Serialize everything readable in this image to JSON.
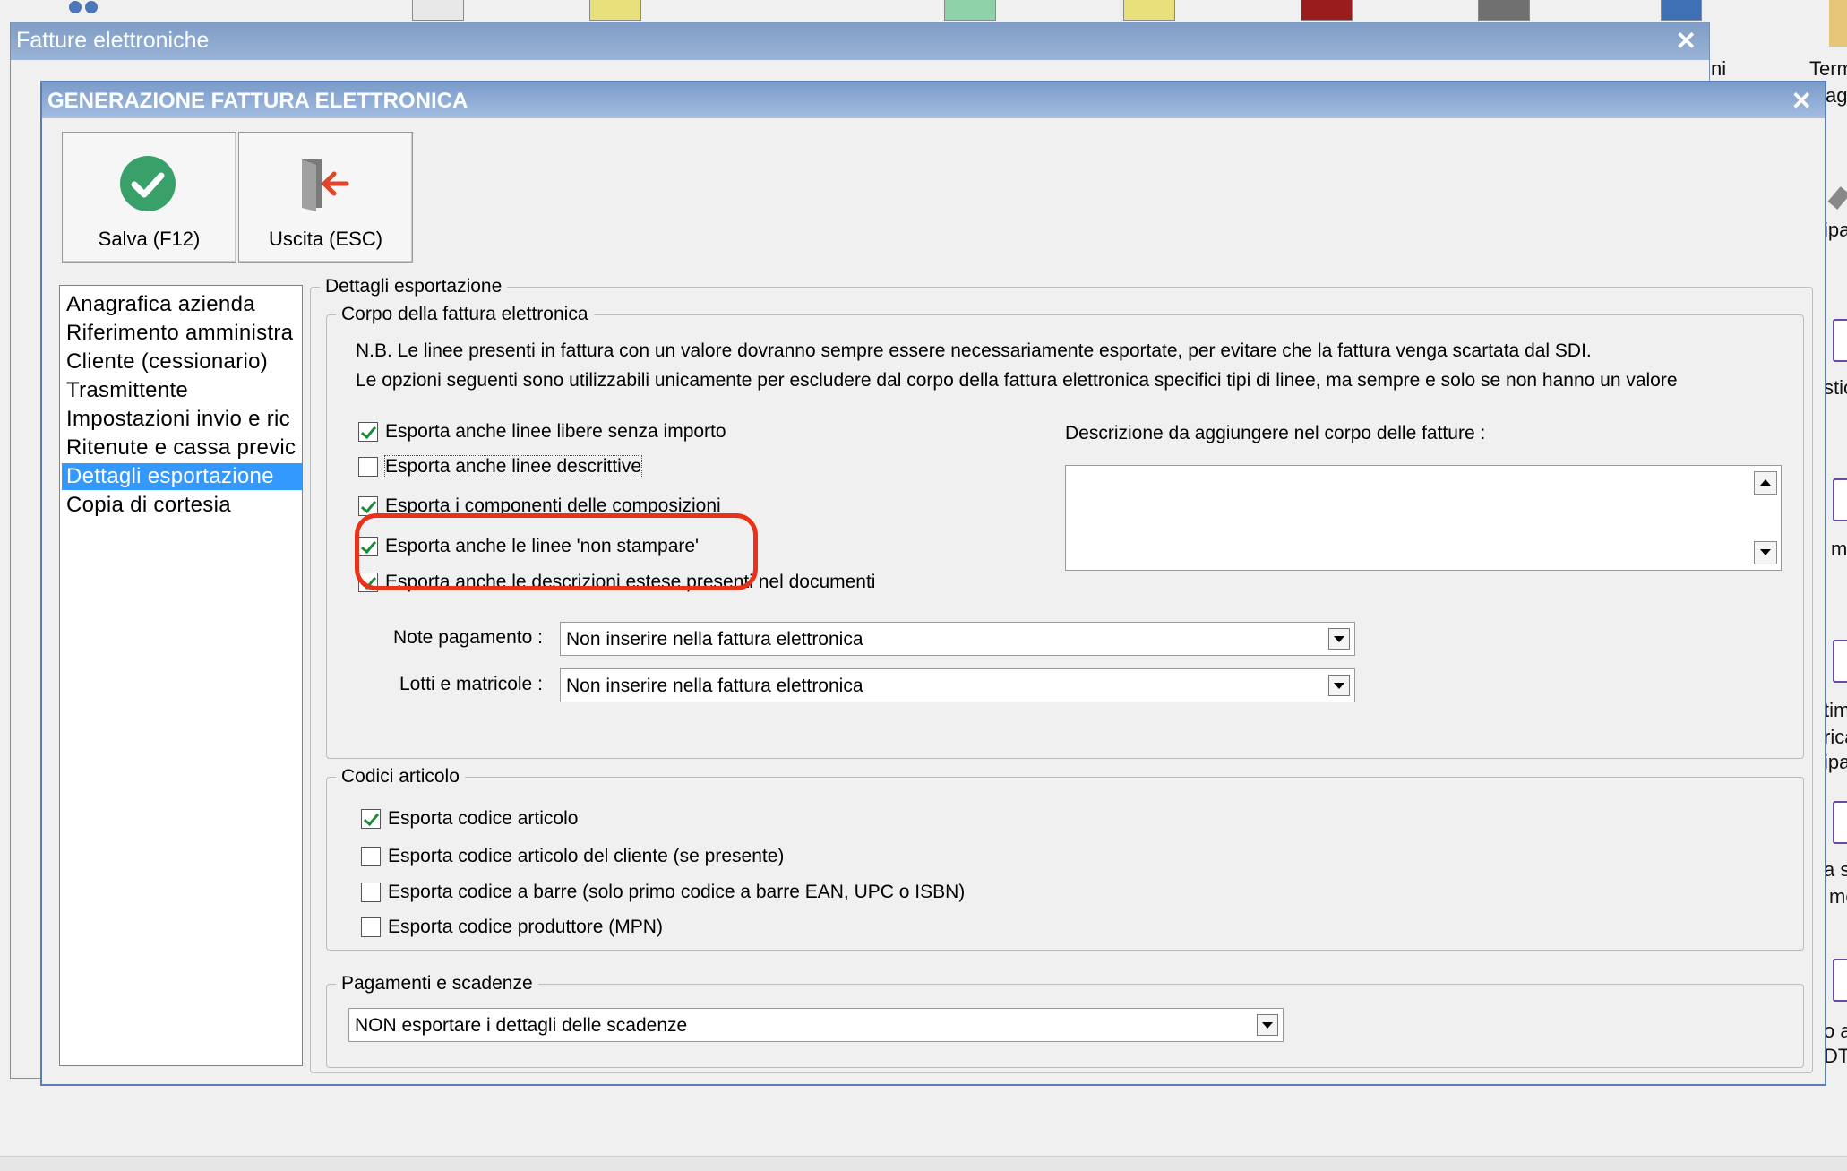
{
  "outer_window": {
    "title": "Fatture elettroniche"
  },
  "dialog": {
    "title": "GENERAZIONE FATTURA ELETTRONICA"
  },
  "toolbar": {
    "save_label": "Salva (F12)",
    "exit_label": "Uscita (ESC)"
  },
  "background": {
    "labels": [
      "Term",
      "ag",
      "ni",
      "ipa",
      "stic",
      "m",
      "tim",
      "rica",
      "ipa",
      "a s",
      "mo",
      "o a",
      "DT"
    ]
  },
  "nav": {
    "items": [
      "Anagrafica azienda",
      "Riferimento amministra",
      "Cliente (cessionario)",
      "Trasmittente",
      "Impostazioni invio e ric",
      "Ritenute e cassa previc",
      "Dettagli esportazione",
      "Copia di cortesia"
    ],
    "selected_index": 6
  },
  "details": {
    "group_title": "Dettagli esportazione",
    "body": {
      "group_title": "Corpo della fattura elettronica",
      "note_line1": "N.B. Le linee presenti in fattura con un valore dovranno sempre essere necessariamente esportate, per evitare che la fattura venga scartata dal SDI.",
      "note_line2": "Le opzioni seguenti sono utilizzabili unicamente per escludere dal corpo della fattura elettronica specifici tipi di linee, ma sempre e solo se non hanno un valore",
      "checkboxes": [
        {
          "label": "Esporta anche linee libere senza importo",
          "checked": true
        },
        {
          "label": "Esporta anche linee descrittive",
          "checked": false
        },
        {
          "label": "Esporta i componenti delle composizioni",
          "checked": true
        },
        {
          "label": "Esporta anche le linee 'non stampare'",
          "checked": true
        },
        {
          "label": "Esporta anche le descrizioni estese presenti nel documenti",
          "checked": true
        }
      ],
      "description_label": "Descrizione da aggiungere nel corpo delle fatture :",
      "description_value": "",
      "note_pagamento_label": "Note pagamento :",
      "note_pagamento_value": "Non inserire nella fattura elettronica",
      "lotti_label": "Lotti e matricole :",
      "lotti_value": "Non inserire nella fattura elettronica"
    },
    "codici": {
      "group_title": "Codici articolo",
      "checkboxes": [
        {
          "label": "Esporta codice articolo",
          "checked": true
        },
        {
          "label": "Esporta codice articolo del cliente (se presente)",
          "checked": false
        },
        {
          "label": "Esporta codice a barre (solo primo codice a barre EAN, UPC o ISBN)",
          "checked": false
        },
        {
          "label": "Esporta codice produttore (MPN)",
          "checked": false
        }
      ]
    },
    "pagamenti": {
      "group_title": "Pagamenti e scadenze",
      "value": "NON esportare i dettagli delle scadenze"
    }
  },
  "colors": {
    "title_bar": "#7e9cc6",
    "selection": "#3399ff",
    "highlight": "#e8321b",
    "check": "#1b8a3a",
    "save_icon": "#3aa06a",
    "exit_arrow": "#e0442a"
  }
}
